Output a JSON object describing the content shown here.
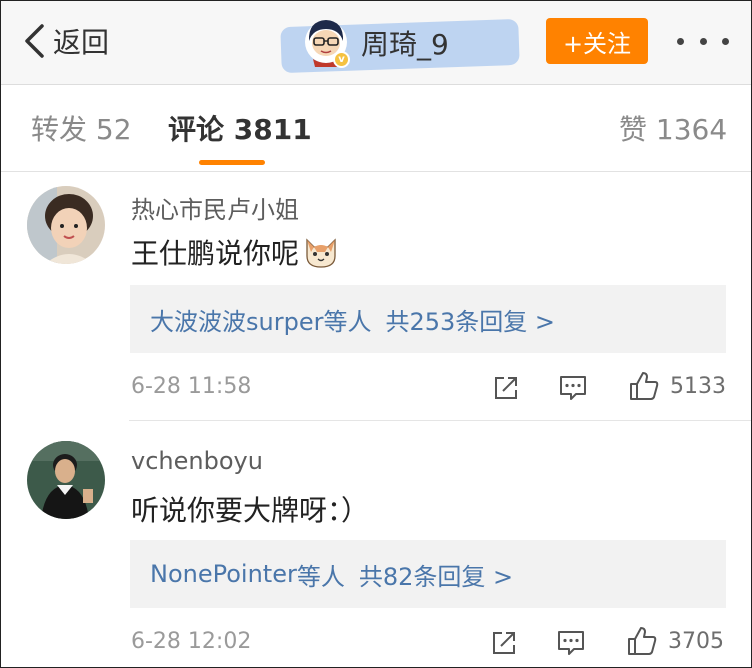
{
  "nav": {
    "back_label": "返回",
    "title": "周琦_9",
    "follow_label": "+关注"
  },
  "tabs": [
    {
      "label": "转发 52"
    },
    {
      "label": "评论 3811"
    },
    {
      "label": "赞 1364"
    }
  ],
  "comments": [
    {
      "username": "热心市民卢小姐",
      "text": "王仕鹏说你呢",
      "reply_users": "大波波波surper",
      "reply_suffix": "等人",
      "reply_count": "共253条回复 >",
      "time": "6-28 11:58",
      "likes": "5133"
    },
    {
      "username": "vchenboyu",
      "text": "听说你要大牌呀：）",
      "reply_users": "NonePointer",
      "reply_suffix": "等人",
      "reply_count": "共82条回复 >",
      "time": "6-28 12:02",
      "likes": "3705"
    }
  ],
  "colors": {
    "accent": "#ff8200",
    "link": "#4a76aa",
    "verify_badge": "#f5c242"
  },
  "icons": [
    "chevron-left-icon",
    "more-icon",
    "verified-icon",
    "cat-emoji-icon",
    "share-icon",
    "comment-icon",
    "like-icon"
  ]
}
